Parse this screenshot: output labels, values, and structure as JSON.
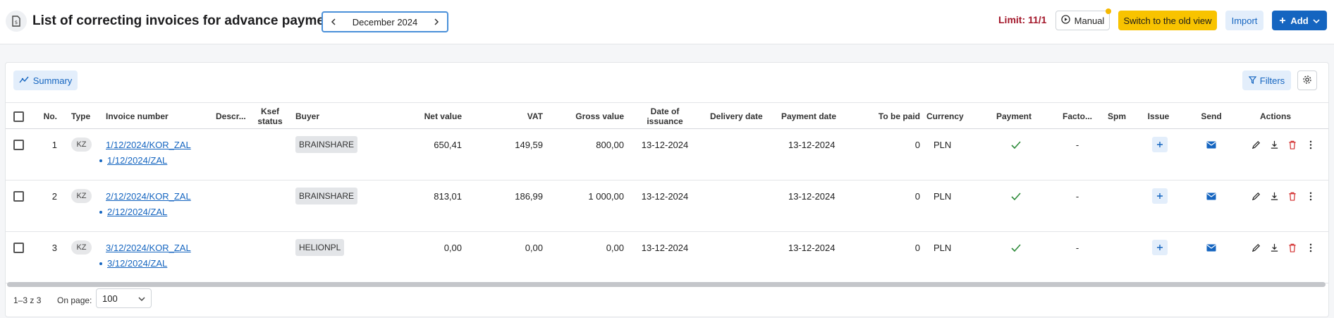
{
  "header": {
    "title": "List of correcting invoices for advance payments",
    "month": "December 2024",
    "limit": "Limit: 11/1",
    "manual_label": "Manual",
    "old_view_label": "Switch to the old view",
    "import_label": "Import",
    "add_label": "Add"
  },
  "toolbar": {
    "summary_label": "Summary",
    "filters_label": "Filters"
  },
  "columns": {
    "no": "No.",
    "type": "Type",
    "invoice_number": "Invoice number",
    "descr": "Descr...",
    "ksef_status": "Ksef status",
    "buyer": "Buyer",
    "net_value": "Net value",
    "vat": "VAT",
    "gross_value": "Gross value",
    "date_of_issuance": "Date of issuance",
    "delivery_date": "Delivery date",
    "payment_date": "Payment date",
    "to_be_paid": "To be paid",
    "currency": "Currency",
    "payment": "Payment",
    "facto": "Facto...",
    "spm": "Spm",
    "issue": "Issue",
    "send": "Send",
    "actions": "Actions"
  },
  "rows": [
    {
      "no": "1",
      "type": "KZ",
      "invoice": "1/12/2024/KOR_ZAL",
      "related": "1/12/2024/ZAL",
      "buyer": "BRAINSHARE",
      "net": "650,41",
      "vat": "149,59",
      "gross": "800,00",
      "issued": "13-12-2024",
      "payment_date": "13-12-2024",
      "to_be_paid": "0",
      "currency": "PLN",
      "facto": "-"
    },
    {
      "no": "2",
      "type": "KZ",
      "invoice": "2/12/2024/KOR_ZAL",
      "related": "2/12/2024/ZAL",
      "buyer": "BRAINSHARE",
      "net": "813,01",
      "vat": "186,99",
      "gross": "1 000,00",
      "issued": "13-12-2024",
      "payment_date": "13-12-2024",
      "to_be_paid": "0",
      "currency": "PLN",
      "facto": "-"
    },
    {
      "no": "3",
      "type": "KZ",
      "invoice": "3/12/2024/KOR_ZAL",
      "related": "3/12/2024/ZAL",
      "buyer": "HELIONPL",
      "net": "0,00",
      "vat": "0,00",
      "gross": "0,00",
      "issued": "13-12-2024",
      "payment_date": "13-12-2024",
      "to_be_paid": "0",
      "currency": "PLN",
      "facto": "-"
    }
  ],
  "footer": {
    "count": "1–3 z 3",
    "on_page_label": "On page:",
    "page_size": "100"
  },
  "colors": {
    "accent": "#1565c0",
    "warning": "#f8c300",
    "limit": "#a3172a",
    "paid": "#2e8b3a",
    "delete": "#d32f2f"
  }
}
